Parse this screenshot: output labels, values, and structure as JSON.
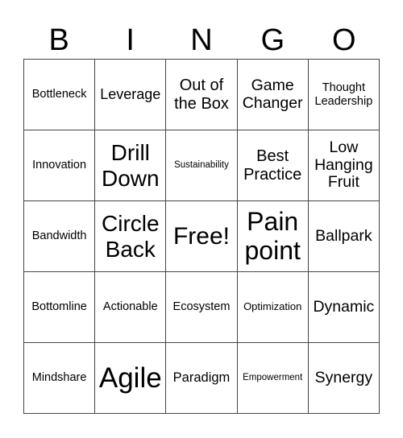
{
  "header": [
    "B",
    "I",
    "N",
    "G",
    "O"
  ],
  "cells": [
    [
      "Bottleneck",
      "Leverage",
      "Out of the Box",
      "Game Changer",
      "Thought Leadership"
    ],
    [
      "Innovation",
      "Drill Down",
      "Sustainability",
      "Best Practice",
      "Low Hanging Fruit"
    ],
    [
      "Bandwidth",
      "Circle Back",
      "Free!",
      "Pain point",
      "Ballpark"
    ],
    [
      "Bottomline",
      "Actionable",
      "Ecosystem",
      "Optimization",
      "Dynamic"
    ],
    [
      "Mindshare",
      "Agile",
      "Paradigm",
      "Empowerment",
      "Synergy"
    ]
  ]
}
